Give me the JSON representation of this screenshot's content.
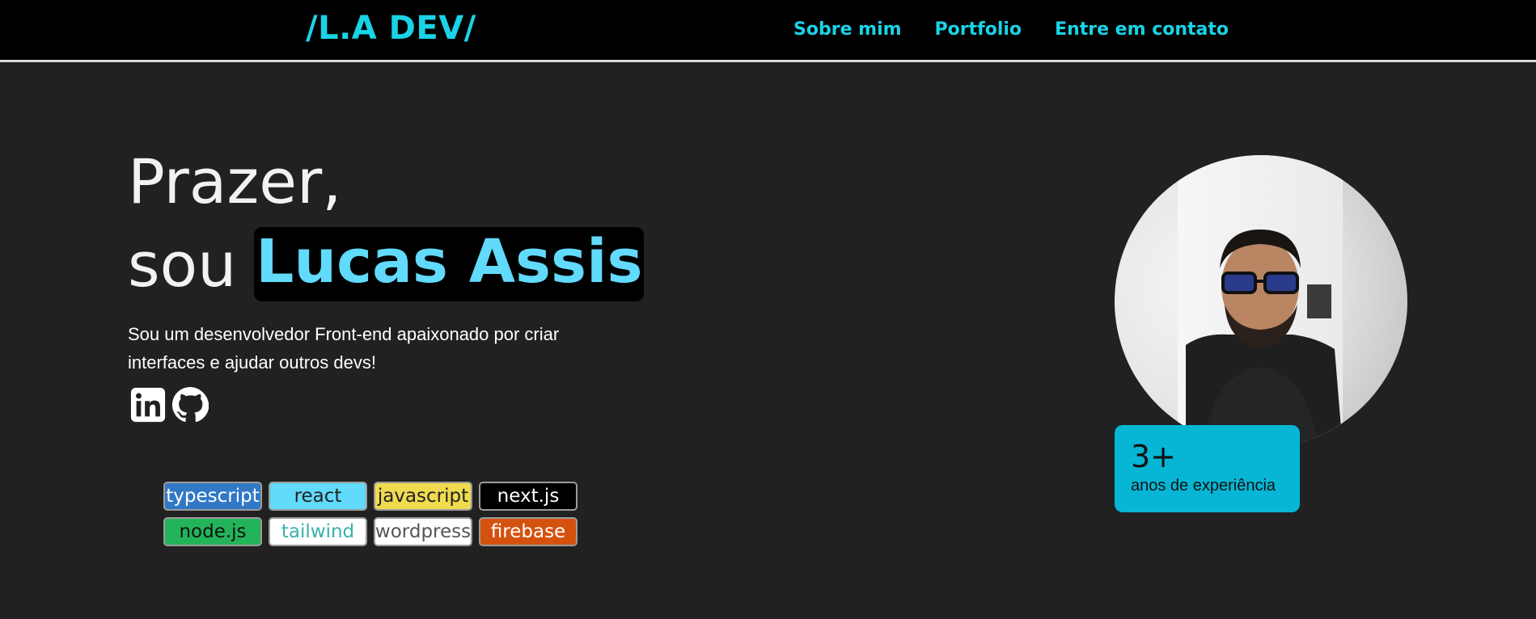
{
  "header": {
    "logo": "/L.A DEV/",
    "nav": [
      {
        "label": "Sobre mim"
      },
      {
        "label": "Portfolio"
      },
      {
        "label": "Entre em contato"
      }
    ]
  },
  "hero": {
    "greeting": "Prazer,",
    "intro_prefix": "sou",
    "name": "Lucas Assis",
    "description": "Sou um desenvolvedor Front-end apaixonado por criar interfaces e ajudar outros devs!",
    "social": [
      {
        "icon": "linkedin-icon"
      },
      {
        "icon": "github-icon"
      }
    ],
    "tags": [
      {
        "label": "typescript",
        "color": "#3178c6"
      },
      {
        "label": "react",
        "color": "#61dafb"
      },
      {
        "label": "javascript",
        "color": "#f0db4f"
      },
      {
        "label": "next.js",
        "color": "#000000"
      },
      {
        "label": "node.js",
        "color": "#23b45a"
      },
      {
        "label": "tailwind",
        "color": "#ffffff"
      },
      {
        "label": "wordpress",
        "color": "#ffffff"
      },
      {
        "label": "firebase",
        "color": "#d4520e"
      }
    ]
  },
  "profile": {
    "experience_value": "3+",
    "experience_label": "anos de experiência"
  },
  "colors": {
    "accent": "#19d3e6",
    "background": "#212121",
    "card": "#06b6d4"
  }
}
